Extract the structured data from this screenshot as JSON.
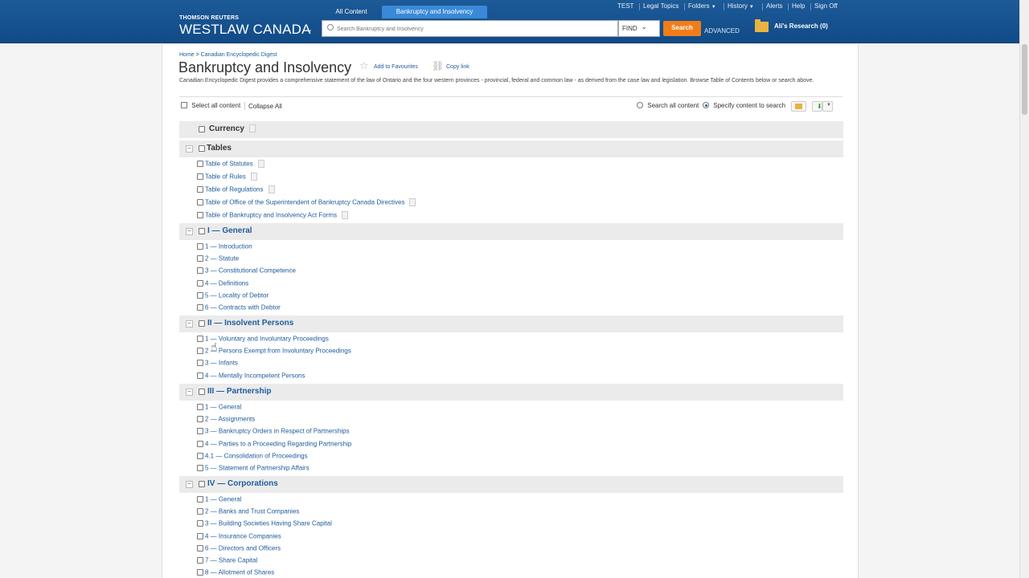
{
  "header": {
    "brand_small": "THOMSON REUTERS",
    "brand_big": "WESTLAW CANADA",
    "tabs": [
      "All Content",
      "Bankruptcy and Insolvency"
    ],
    "search_placeholder": "Search Bankruptcy and Insolvency",
    "find_label": "FIND",
    "search_button": "Search",
    "advanced": "ADVANCED",
    "research_folder": "Ali's Research (0)",
    "top_nav": [
      "TEST",
      "Legal Topics",
      "Folders",
      "History",
      "Alerts",
      "Help",
      "Sign Off"
    ]
  },
  "page": {
    "breadcrumb_home": "Home",
    "breadcrumb_sep": " > ",
    "breadcrumb_current": "Canadian Encyclopedic Digest",
    "title": "Bankruptcy and Insolvency",
    "add_to_favourites": "Add to Favourites",
    "copy_link": "Copy link",
    "description": "Canadian Encyclopedic Digest provides a comprehensive statement of the law of Ontario and the four western provinces - provincial, federal and common law - as derived from the case law and legislation. Browse Table of Contents below or search above.",
    "select_all": "Select all content",
    "collapse_all": "Collapse All",
    "search_all_content": "Search all content",
    "specify_content": "Specify content to search"
  },
  "toc": {
    "currency": "Currency",
    "sections": [
      {
        "title": "Tables",
        "items": [
          "Table of Statutes",
          "Table of Rules",
          "Table of Regulations",
          "Table of Office of the Superintendent of Bankruptcy Canada Directives",
          "Table of Bankruptcy and Insolvency Act Forms"
        ]
      },
      {
        "title": "I — General",
        "items": [
          "1 — Introduction",
          "2 — Statute",
          "3 — Constitutional Competence",
          "4 — Definitions",
          "5 — Locality of Debtor",
          "6 — Contracts with Debtor"
        ]
      },
      {
        "title": "II — Insolvent Persons",
        "items": [
          "1 — Voluntary and Involuntary Proceedings",
          "2 — Persons Exempt from Involuntary Proceedings",
          "3 — Infants",
          "4 — Mentally Incompetent Persons"
        ]
      },
      {
        "title": "III — Partnership",
        "items": [
          "1 — General",
          "2 — Assignments",
          "3 — Bankruptcy Orders in Respect of Partnerships",
          "4 — Parties to a Proceeding Regarding Partnership",
          "4.1 — Consolidation of Proceedings",
          "5 — Statement of Partnership Affairs"
        ]
      },
      {
        "title": "IV — Corporations",
        "items": [
          "1 — General",
          "2 — Banks and Trust Companies",
          "3 — Building Societies Having Share Capital",
          "4 — Insurance Companies",
          "6 — Directors and Officers",
          "7 — Share Capital",
          "8 — Allotment of Shares"
        ]
      }
    ]
  }
}
